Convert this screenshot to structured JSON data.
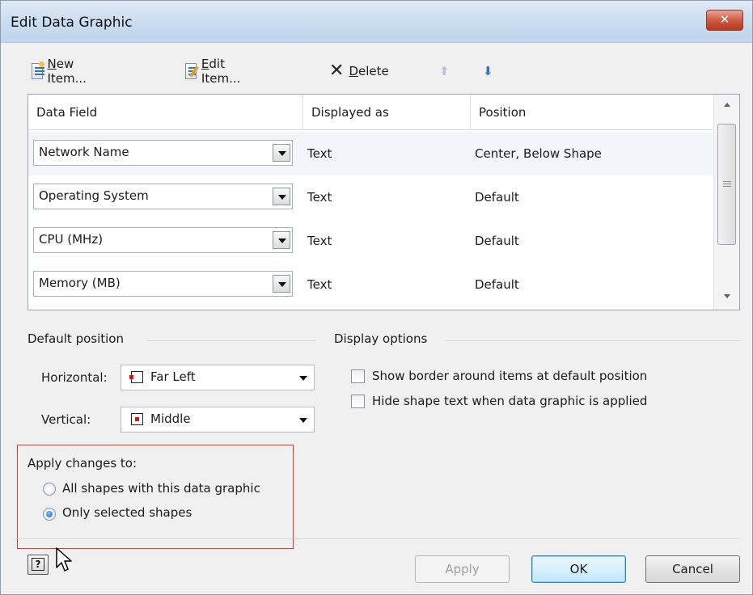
{
  "window": {
    "title": "Edit Data Graphic",
    "close_glyph": "✕"
  },
  "toolbar": {
    "new_item": {
      "prefix": "",
      "mnemonic": "N",
      "rest": "ew Item..."
    },
    "edit_item": {
      "prefix": "",
      "mnemonic": "E",
      "rest": "dit Item..."
    },
    "delete": {
      "prefix": "",
      "mnemonic": "D",
      "rest": "elete"
    },
    "up_icon": "arrow-up-icon",
    "down_icon": "arrow-down-icon"
  },
  "grid": {
    "columns": [
      "Data Field",
      "Displayed as",
      "Position"
    ],
    "rows": [
      {
        "field": "Network Name",
        "displayed_as": "Text",
        "position": "Center, Below Shape"
      },
      {
        "field": "Operating System",
        "displayed_as": "Text",
        "position": "Default"
      },
      {
        "field": "CPU (MHz)",
        "displayed_as": "Text",
        "position": "Default"
      },
      {
        "field": "Memory (MB)",
        "displayed_as": "Text",
        "position": "Default"
      }
    ]
  },
  "default_position": {
    "heading": "Default position",
    "horizontal_label": "Horizontal:",
    "horizontal_value": "Far Left",
    "vertical_label": "Vertical:",
    "vertical_value": "Middle"
  },
  "display_options": {
    "heading": "Display options",
    "show_border": {
      "label": "Show border around items at default position",
      "checked": false
    },
    "hide_text": {
      "label": "Hide shape text when data graphic is applied",
      "checked": false
    }
  },
  "apply_changes": {
    "heading": "Apply changes to:",
    "options": [
      {
        "label": "All shapes with this data graphic",
        "selected": false
      },
      {
        "label": "Only selected shapes",
        "selected": true
      }
    ]
  },
  "buttons": {
    "help": "?",
    "apply": "Apply",
    "ok": "OK",
    "cancel": "Cancel"
  },
  "colors": {
    "highlight_box": "#e03535",
    "accent": "#1c63b8"
  }
}
